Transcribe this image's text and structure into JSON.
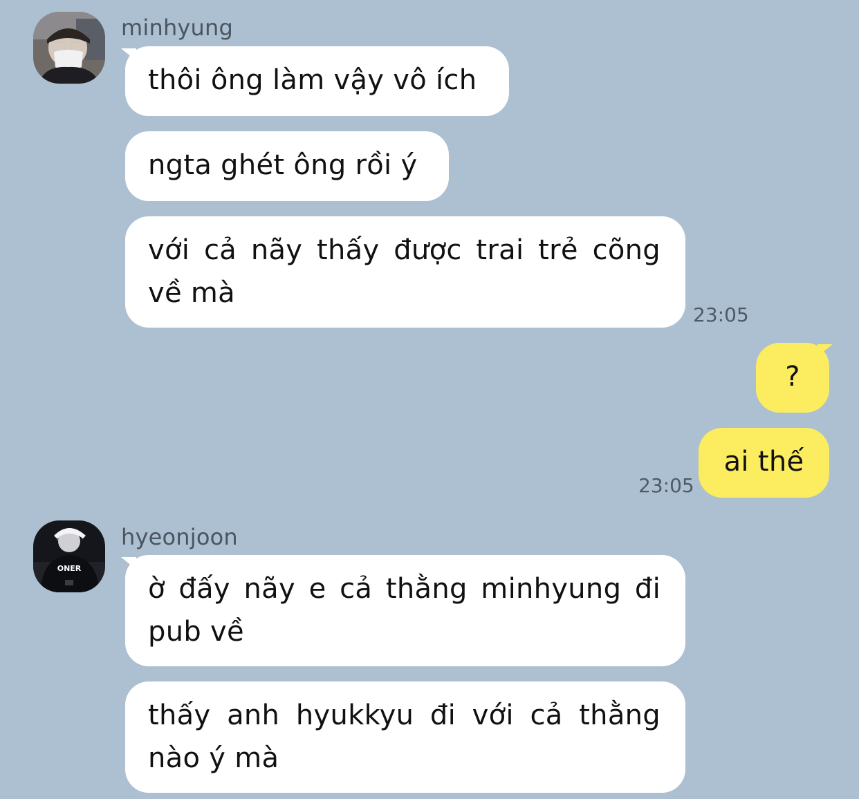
{
  "messages": [
    {
      "sender": "minhyung",
      "avatar_icon": "masked-person-avatar",
      "bubbles": [
        "thôi ông làm vậy vô ích",
        "ngta ghét ông rồi ý",
        "với cả nãy thấy được trai trẻ cõng về mà"
      ],
      "time": "23:05"
    },
    {
      "sender": "me",
      "bubbles": [
        "?",
        "ai thế"
      ],
      "time": "23:05"
    },
    {
      "sender": "hyeonjoon",
      "avatar_icon": "player-jersey-avatar",
      "avatar_text": "ONER",
      "bubbles": [
        "ờ đấy nãy e cả thằng minhyung đi pub về",
        "thấy anh hyukkyu đi với cả thằng nào ý mà"
      ]
    }
  ],
  "colors": {
    "background": "#acc0d2",
    "incoming_bubble": "#ffffff",
    "outgoing_bubble": "#fcec5f",
    "timestamp": "#4f5a66"
  }
}
